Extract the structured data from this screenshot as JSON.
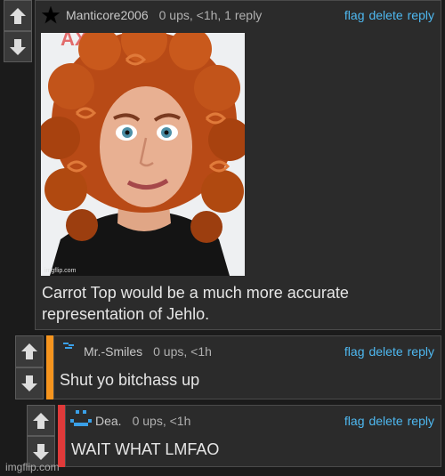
{
  "comments": [
    {
      "username": "Manticore2006",
      "stats": "0 ups, <1h, 1 reply",
      "body": "Carrot Top would be a much more accurate representation of Jehlo.",
      "links": {
        "flag": "flag",
        "delete": "delete",
        "reply": "reply"
      },
      "avatar_icon": "star-icon",
      "image_watermark": "imgflip.com"
    },
    {
      "username": "Mr.-Smiles",
      "stats": "0 ups, <1h",
      "body": "Shut yo bitchass up",
      "links": {
        "flag": "flag",
        "delete": "delete",
        "reply": "reply"
      },
      "accent_color": "#f5941e"
    },
    {
      "username": "Dea.",
      "stats": "0 ups, <1h",
      "body": "WAIT WHAT LMFAO",
      "links": {
        "flag": "flag",
        "delete": "delete",
        "reply": "reply"
      },
      "accent_color": "#e03a3a"
    }
  ],
  "watermark": "imgflip.com",
  "colors": {
    "link": "#4eb8f0",
    "panel": "#2b2b2b",
    "background": "#1b1b1b"
  }
}
